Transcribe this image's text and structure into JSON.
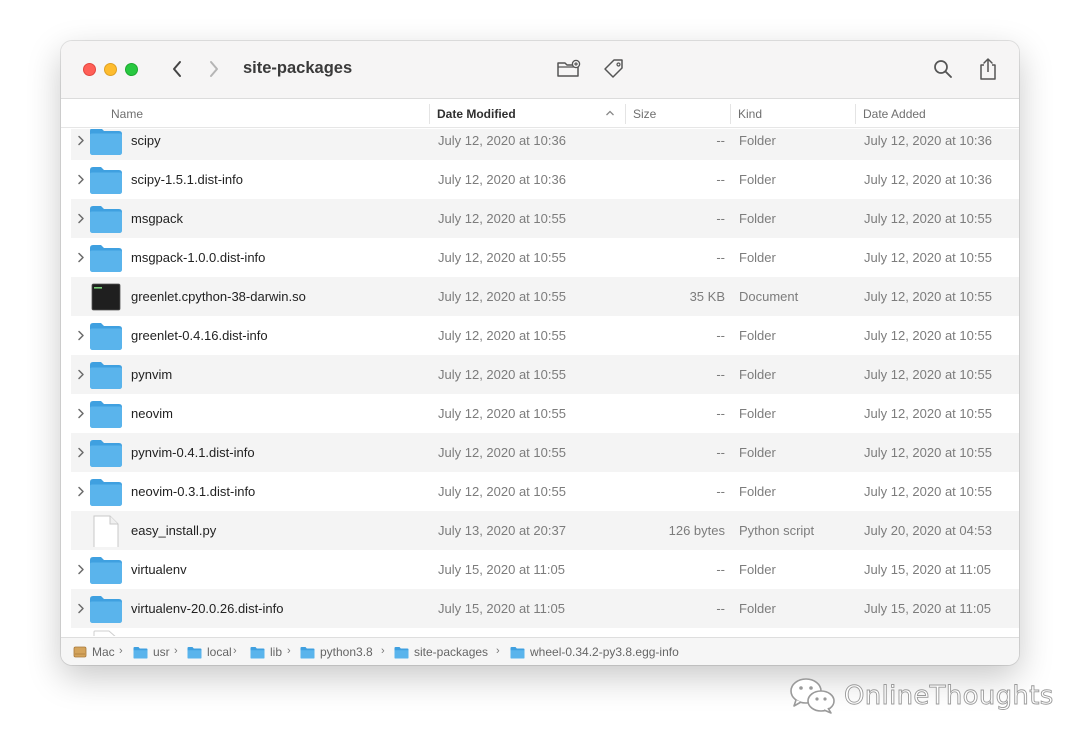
{
  "window": {
    "title": "site-packages"
  },
  "toolbar": {
    "back_icon": "chevron-left-icon",
    "forward_icon": "chevron-right-icon",
    "new_folder_icon": "new-folder-icon",
    "tag_icon": "tag-icon",
    "search_icon": "search-icon",
    "share_icon": "share-icon"
  },
  "columns": {
    "name": "Name",
    "date_modified": "Date Modified",
    "size": "Size",
    "kind": "Kind",
    "date_added": "Date Added"
  },
  "files": [
    {
      "name": "scipy",
      "date": "July 12, 2020 at 10:36",
      "size": "--",
      "kind": "Folder",
      "added": "July 12, 2020 at 10:36",
      "icon": "folder-icon"
    },
    {
      "name": "scipy-1.5.1.dist-info",
      "date": "July 12, 2020 at 10:36",
      "size": "--",
      "kind": "Folder",
      "added": "July 12, 2020 at 10:36",
      "icon": "folder-icon"
    },
    {
      "name": "msgpack",
      "date": "July 12, 2020 at 10:55",
      "size": "--",
      "kind": "Folder",
      "added": "July 12, 2020 at 10:55",
      "icon": "folder-icon"
    },
    {
      "name": "msgpack-1.0.0.dist-info",
      "date": "July 12, 2020 at 10:55",
      "size": "--",
      "kind": "Folder",
      "added": "July 12, 2020 at 10:55",
      "icon": "folder-icon"
    },
    {
      "name": "greenlet.cpython-38-darwin.so",
      "date": "July 12, 2020 at 10:55",
      "size": "35 KB",
      "kind": "Document",
      "added": "July 12, 2020 at 10:55",
      "icon": "terminal-exec-icon"
    },
    {
      "name": "greenlet-0.4.16.dist-info",
      "date": "July 12, 2020 at 10:55",
      "size": "--",
      "kind": "Folder",
      "added": "July 12, 2020 at 10:55",
      "icon": "folder-icon"
    },
    {
      "name": "pynvim",
      "date": "July 12, 2020 at 10:55",
      "size": "--",
      "kind": "Folder",
      "added": "July 12, 2020 at 10:55",
      "icon": "folder-icon"
    },
    {
      "name": "neovim",
      "date": "July 12, 2020 at 10:55",
      "size": "--",
      "kind": "Folder",
      "added": "July 12, 2020 at 10:55",
      "icon": "folder-icon"
    },
    {
      "name": "pynvim-0.4.1.dist-info",
      "date": "July 12, 2020 at 10:55",
      "size": "--",
      "kind": "Folder",
      "added": "July 12, 2020 at 10:55",
      "icon": "folder-icon"
    },
    {
      "name": "neovim-0.3.1.dist-info",
      "date": "July 12, 2020 at 10:55",
      "size": "--",
      "kind": "Folder",
      "added": "July 12, 2020 at 10:55",
      "icon": "folder-icon"
    },
    {
      "name": "easy_install.py",
      "date": "July 13, 2020 at 20:37",
      "size": "126 bytes",
      "kind": "Python script",
      "added": "July 20, 2020 at 04:53",
      "icon": "document-icon"
    },
    {
      "name": "virtualenv",
      "date": "July 15, 2020 at 11:05",
      "size": "--",
      "kind": "Folder",
      "added": "July 15, 2020 at 11:05",
      "icon": "folder-icon"
    },
    {
      "name": "virtualenv-20.0.26.dist-info",
      "date": "July 15, 2020 at 11:05",
      "size": "--",
      "kind": "Folder",
      "added": "July 15, 2020 at 11:05",
      "icon": "folder-icon"
    }
  ],
  "pathbar": {
    "items": [
      "Mac",
      "usr",
      "local",
      "lib",
      "python3.8",
      "site-packages",
      "wheel-0.34.2-py3.8.egg-info"
    ]
  },
  "watermark": {
    "text": "OnlineThoughts",
    "icon": "wechat-icon"
  },
  "colors": {
    "folder": "#5ab4ec",
    "close": "#ff5f57",
    "minimize": "#febc2e",
    "maximize": "#28c840"
  }
}
